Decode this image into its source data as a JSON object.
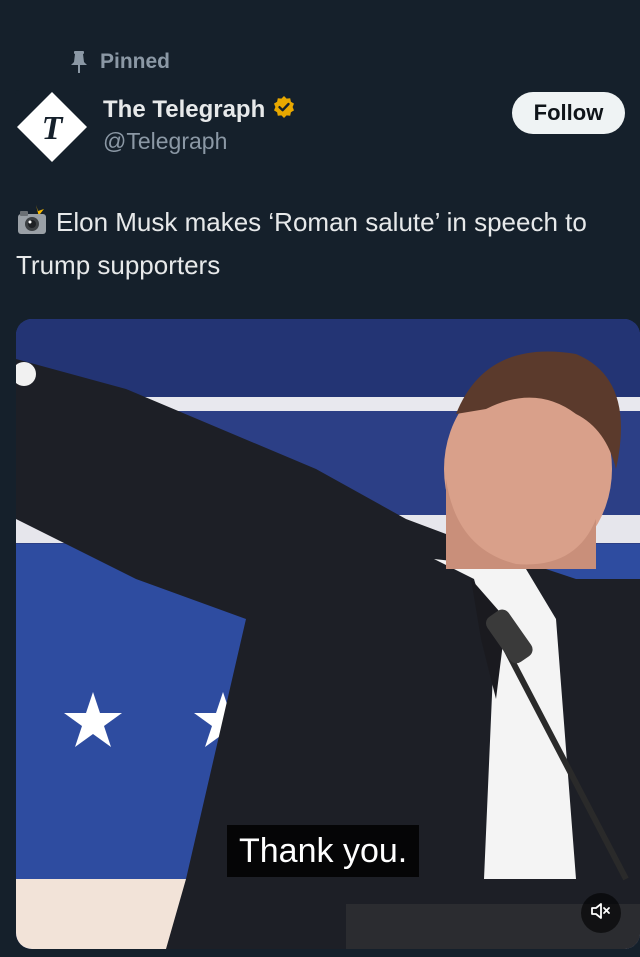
{
  "pinned": {
    "label": "Pinned",
    "icon": "pin-icon"
  },
  "account": {
    "display_name": "The Telegraph",
    "handle": "@Telegraph",
    "verified_badge_color": "#e8a800",
    "avatar_letter": "T"
  },
  "follow_button": {
    "label": "Follow"
  },
  "tweet": {
    "emoji": "camera-flash-icon",
    "text": "Elon Musk makes ‘Roman salute’ in speech to Trump supporters"
  },
  "media": {
    "type": "video",
    "caption": "Thank you.",
    "mute_icon": "volume-muted-icon"
  },
  "colors": {
    "background": "#15202b",
    "primary_text": "#e7e9ea",
    "secondary_text": "#8b98a5",
    "follow_bg": "#eff3f4"
  }
}
